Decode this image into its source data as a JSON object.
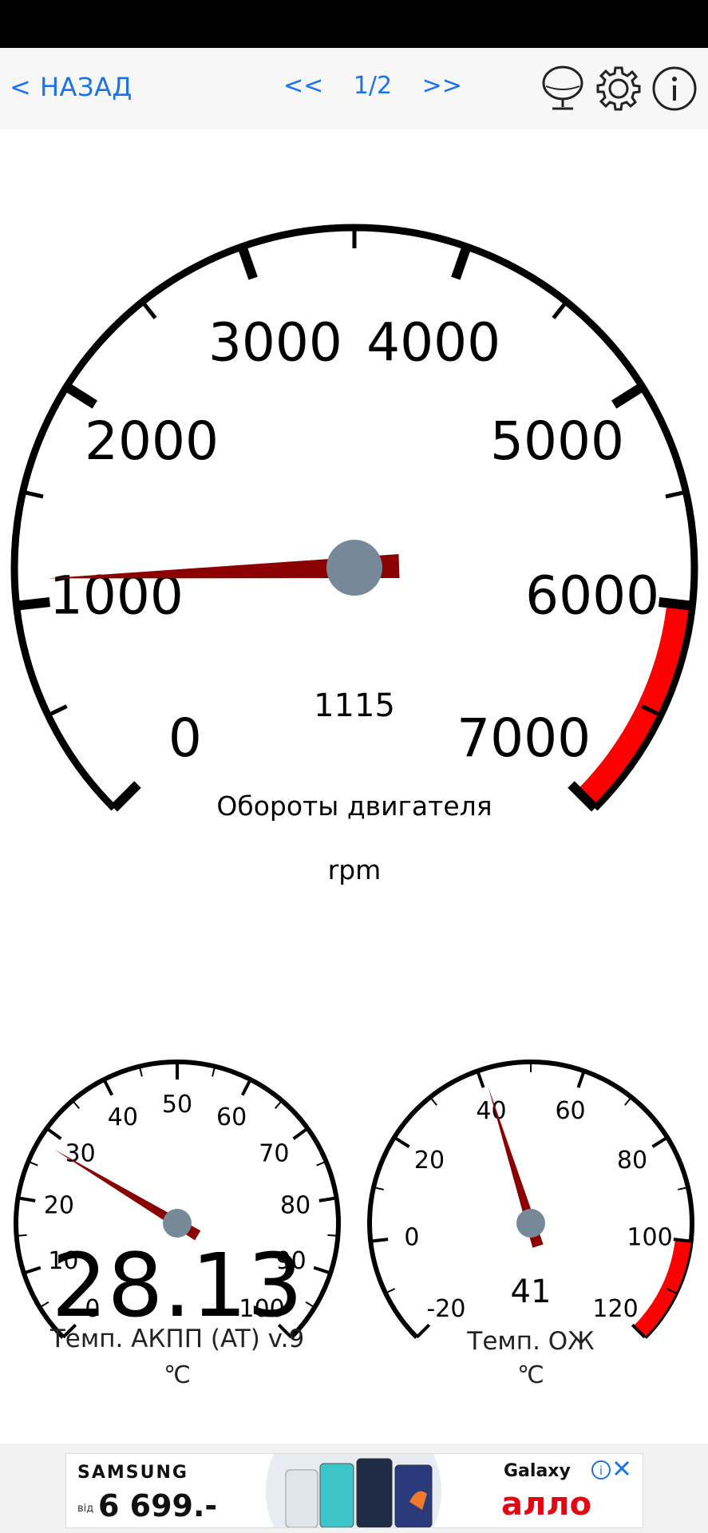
{
  "toolbar": {
    "back_label": "< НАЗАД",
    "prev_label": "<<",
    "page_indicator": "1/2",
    "next_label": ">>",
    "icons": [
      "microphone-icon",
      "gear-icon",
      "info-icon"
    ]
  },
  "gauges": {
    "rpm": {
      "title": "Обороты двигателя",
      "unit": "rpm",
      "value_text": "1115",
      "value": 1115,
      "min": 0,
      "max": 7000,
      "labels": [
        "0",
        "1000",
        "2000",
        "3000",
        "4000",
        "5000",
        "6000",
        "7000"
      ],
      "redzone_from": 6000,
      "redzone_color": "#ff0000"
    },
    "transmission_temp": {
      "title": "Темп. АКПП (AT) v.9",
      "unit": "℃",
      "value_text": "28.13",
      "value": 28.13,
      "min": 0,
      "max": 100,
      "labels": [
        "0",
        "10",
        "20",
        "30",
        "40",
        "50",
        "60",
        "70",
        "80",
        "90",
        "100"
      ]
    },
    "coolant_temp": {
      "title": "Темп. ОЖ",
      "unit": "℃",
      "value_text": "41",
      "value": 41,
      "min": -20,
      "max": 120,
      "labels": [
        "-20",
        "0",
        "20",
        "40",
        "60",
        "80",
        "100",
        "120"
      ],
      "redzone_from": 100,
      "redzone_color": "#ff0000"
    }
  },
  "colors": {
    "accent": "#1a73e8",
    "needle": "#8b0000",
    "hub": "#778899",
    "redzone": "#ff0000"
  },
  "ad": {
    "brand_left": "SAMSUNG",
    "price_prefix": "від",
    "price": "6 699.-",
    "brand_right": "Galaxy",
    "store": "алло"
  }
}
